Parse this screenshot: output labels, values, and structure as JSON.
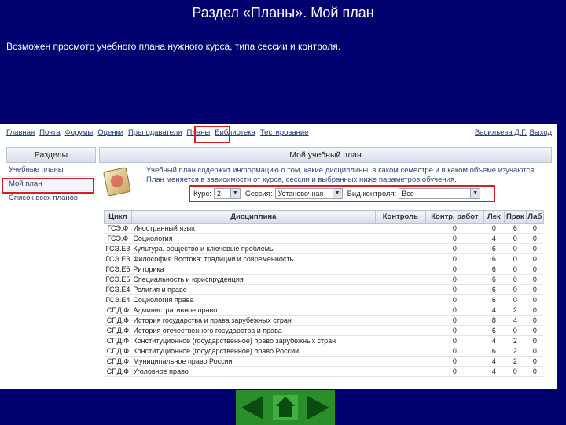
{
  "slide": {
    "title": "Раздел «Планы». Мой план",
    "text": "Возможен просмотр учебного плана нужного курса, типа сессии и контроля."
  },
  "menu": {
    "items": [
      "Главная",
      "Почта",
      "Форумы",
      "Оценки",
      "Преподаватели",
      "Планы",
      "Библиотека",
      "Тестирование"
    ],
    "user": "Васильева Д.Г.",
    "exit": "Выход"
  },
  "left_panel": {
    "header": "Разделы",
    "items": [
      "Учебные планы",
      "Мой план",
      "Список всех планов"
    ]
  },
  "main": {
    "header": "Мой учебный план",
    "info": "Учебный план содержит информацию о том, какие дисциплины, в каком семестре и в каком объеме изучаются. План меняется в зависимости от курса, сессии и выбранных ниже параметров обучения.",
    "filters": {
      "course_label": "Курс:",
      "course_value": "2",
      "session_label": "Сессия:",
      "session_value": "Установочная",
      "control_label": "Вид контроля:",
      "control_value": "Все"
    }
  },
  "table": {
    "headers": [
      "Цикл",
      "Дисциплина",
      "Контроль",
      "Контр. работ",
      "Лек",
      "Прак",
      "Лаб"
    ],
    "rows": [
      [
        "ГСЭ.Ф",
        "Иностранный язык",
        "",
        "0",
        "0",
        "6",
        "0"
      ],
      [
        "ГСЭ.Ф",
        "Социология",
        "",
        "0",
        "4",
        "0",
        "0"
      ],
      [
        "ГСЭ.Е3",
        "Культура, общество и ключевые проблемы",
        "",
        "0",
        "6",
        "0",
        "0"
      ],
      [
        "ГСЭ.Е3",
        "Философия Востока: традиции и современность",
        "",
        "0",
        "6",
        "0",
        "0"
      ],
      [
        "ГСЭ.Е5",
        "Риторика",
        "",
        "0",
        "6",
        "0",
        "0"
      ],
      [
        "ГСЭ.Е5",
        "Специальность и юриспруденция",
        "",
        "0",
        "6",
        "0",
        "0"
      ],
      [
        "ГСЭ.Е4",
        "Религия и право",
        "",
        "0",
        "6",
        "0",
        "0"
      ],
      [
        "ГСЭ.Е4",
        "Социология права",
        "",
        "0",
        "6",
        "0",
        "0"
      ],
      [
        "СПД.Ф",
        "Административное право",
        "",
        "0",
        "4",
        "2",
        "0"
      ],
      [
        "СПД.Ф",
        "История государства и права зарубежных стран",
        "",
        "0",
        "8",
        "4",
        "0"
      ],
      [
        "СПД.Ф",
        "История отечественного государства и права",
        "",
        "0",
        "6",
        "0",
        "0"
      ],
      [
        "СПД.Ф",
        "Конституционное (государственное) право зарубежных стран",
        "",
        "0",
        "4",
        "2",
        "0"
      ],
      [
        "СПД.Ф",
        "Конституционное (государственное) право России",
        "",
        "0",
        "6",
        "2",
        "0"
      ],
      [
        "СПД.Ф",
        "Муниципальное право России",
        "",
        "0",
        "4",
        "2",
        "0"
      ],
      [
        "СПД.Ф",
        "Уголовное право",
        "",
        "0",
        "4",
        "0",
        "0"
      ]
    ]
  },
  "colors": {
    "slide_bg": "#00006e",
    "highlight": "#d42020",
    "nav_green": "#2a8f2a"
  },
  "nav": {
    "prev_icon": "arrow-left-icon",
    "home_icon": "home-icon",
    "next_icon": "arrow-right-icon"
  }
}
